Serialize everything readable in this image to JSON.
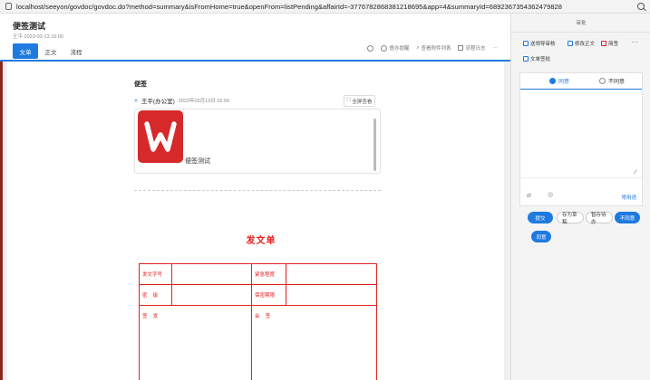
{
  "browser": {
    "url": "localhost/seeyon/govdoc/govdoc.do?method=summary&isFromHome=true&openFrom=listPending&affairId=-3776782868381218695&app=4&summaryId=6892367354362479828"
  },
  "header": {
    "title": "便签测试",
    "meta": "王平 2023-03-13 15:00",
    "tabs": [
      "文单",
      "正文",
      "流程"
    ],
    "tools": [
      "督办提醒",
      "查看附件列表",
      "流程日志"
    ]
  },
  "sticky": {
    "heading": "便签",
    "user": "王平(办公室)",
    "time": "2023年03月13日 15:00",
    "fullview_label": "全屏查看",
    "note_text": "便签测试"
  },
  "form": {
    "title": "发文单",
    "rows": [
      [
        "发文字号",
        "",
        "紧急程度",
        ""
      ],
      [
        "密    级",
        "",
        "保密期限",
        ""
      ],
      [
        "签    发",
        "会    签"
      ]
    ]
  },
  "right_panel": {
    "title": "审批",
    "options": [
      "送领导审核",
      "修改正文",
      "简签",
      "文单签批"
    ],
    "agree_label": "同意",
    "disagree_label": "不同意",
    "common_label": "常用语",
    "buttons": [
      "提交",
      "存为草稿",
      "暂存待办",
      "不同意",
      "同意"
    ]
  },
  "colors": {
    "accent": "#1f7ae0",
    "form_red": "#e02020",
    "wps_red": "#d62a2a"
  }
}
